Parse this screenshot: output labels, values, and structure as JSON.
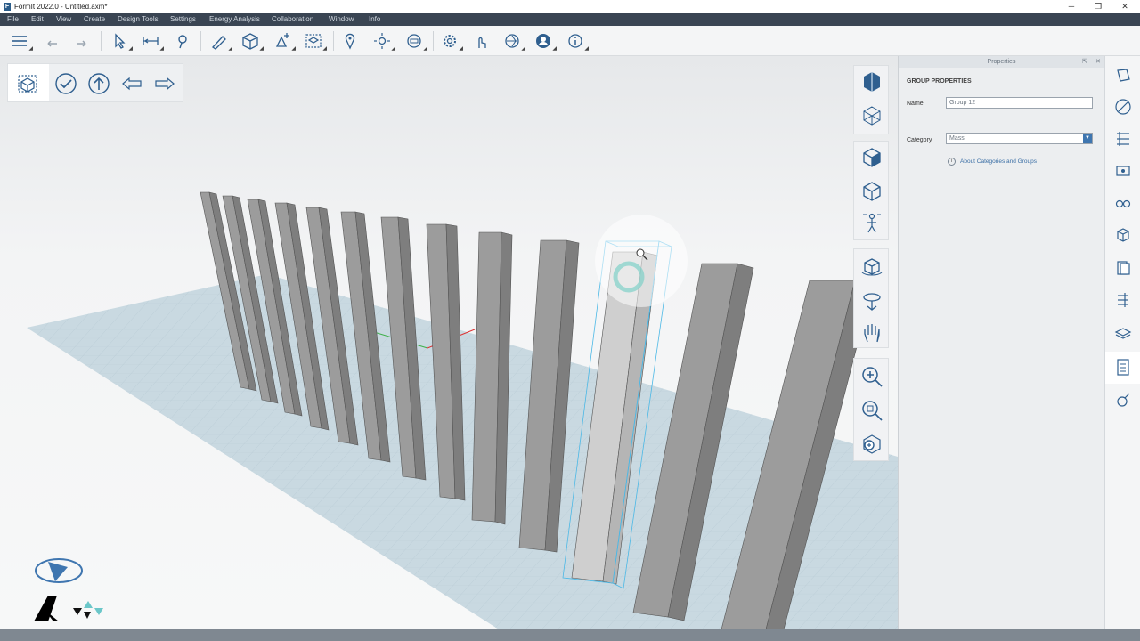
{
  "window": {
    "title": "FormIt 2022.0 - Untitled.axm*",
    "app_logo": "F",
    "controls": {
      "minimize": "─",
      "maximize": "❐",
      "close": "✕"
    }
  },
  "menu": [
    "File",
    "Edit",
    "View",
    "Create",
    "Design Tools",
    "Settings",
    "Energy Analysis",
    "Collaboration",
    "Window",
    "Info"
  ],
  "toolbar_icons": [
    "layers-icon",
    "undo-icon",
    "redo-icon",
    "select-icon",
    "dimension-icon",
    "paint-icon",
    "sketch-pen-icon",
    "cube-icon",
    "solid-tools-icon",
    "group-icon",
    "location-icon",
    "sun-icon",
    "scene-icon",
    "settings-icon",
    "touch-icon",
    "share-icon",
    "account-icon",
    "info-icon"
  ],
  "edit_group_bar": [
    "edit-group-icon",
    "check-icon",
    "up-arrow-icon",
    "back-arrow-icon",
    "forward-arrow-icon"
  ],
  "properties": {
    "header": "Properties",
    "header_buttons": {
      "pin": "⇱",
      "close": "✕"
    },
    "section_title": "GROUP PROPERTIES",
    "name_label": "Name",
    "name_value": "Group 12",
    "category_label": "Category",
    "category_value": "Mass",
    "category_arrow": "▼",
    "info_icon": "i",
    "info_link": "About Categories and Groups"
  },
  "colors": {
    "accent": "#3f76b0",
    "menubar": "#3a4553",
    "selection": "#4bb8e6",
    "ground": "#c8d8e0"
  }
}
